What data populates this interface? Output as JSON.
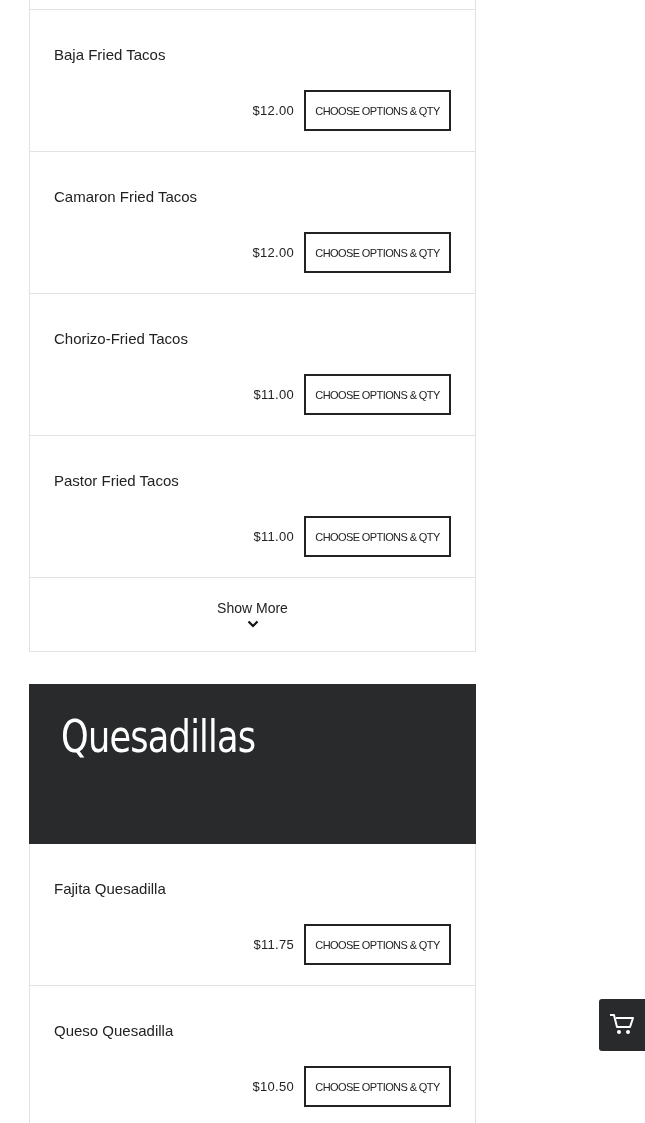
{
  "sections": [
    {
      "items": [
        {
          "name": "Baja Fried Tacos",
          "price": "$12.00",
          "button": "CHOOSE OPTIONS & QTY"
        },
        {
          "name": "Camaron Fried Tacos",
          "price": "$12.00",
          "button": "CHOOSE OPTIONS & QTY"
        },
        {
          "name": "Chorizo-Fried Tacos",
          "price": "$11.00",
          "button": "CHOOSE OPTIONS & QTY"
        },
        {
          "name": "Pastor Fried Tacos",
          "price": "$11.00",
          "button": "CHOOSE OPTIONS & QTY"
        }
      ],
      "show_more": "Show More"
    },
    {
      "title": "Quesadillas",
      "items": [
        {
          "name": "Fajita Quesadilla",
          "price": "$11.75",
          "button": "CHOOSE OPTIONS & QTY"
        },
        {
          "name": "Queso Quesadilla",
          "price": "$10.50",
          "button": "CHOOSE OPTIONS & QTY"
        }
      ]
    }
  ]
}
